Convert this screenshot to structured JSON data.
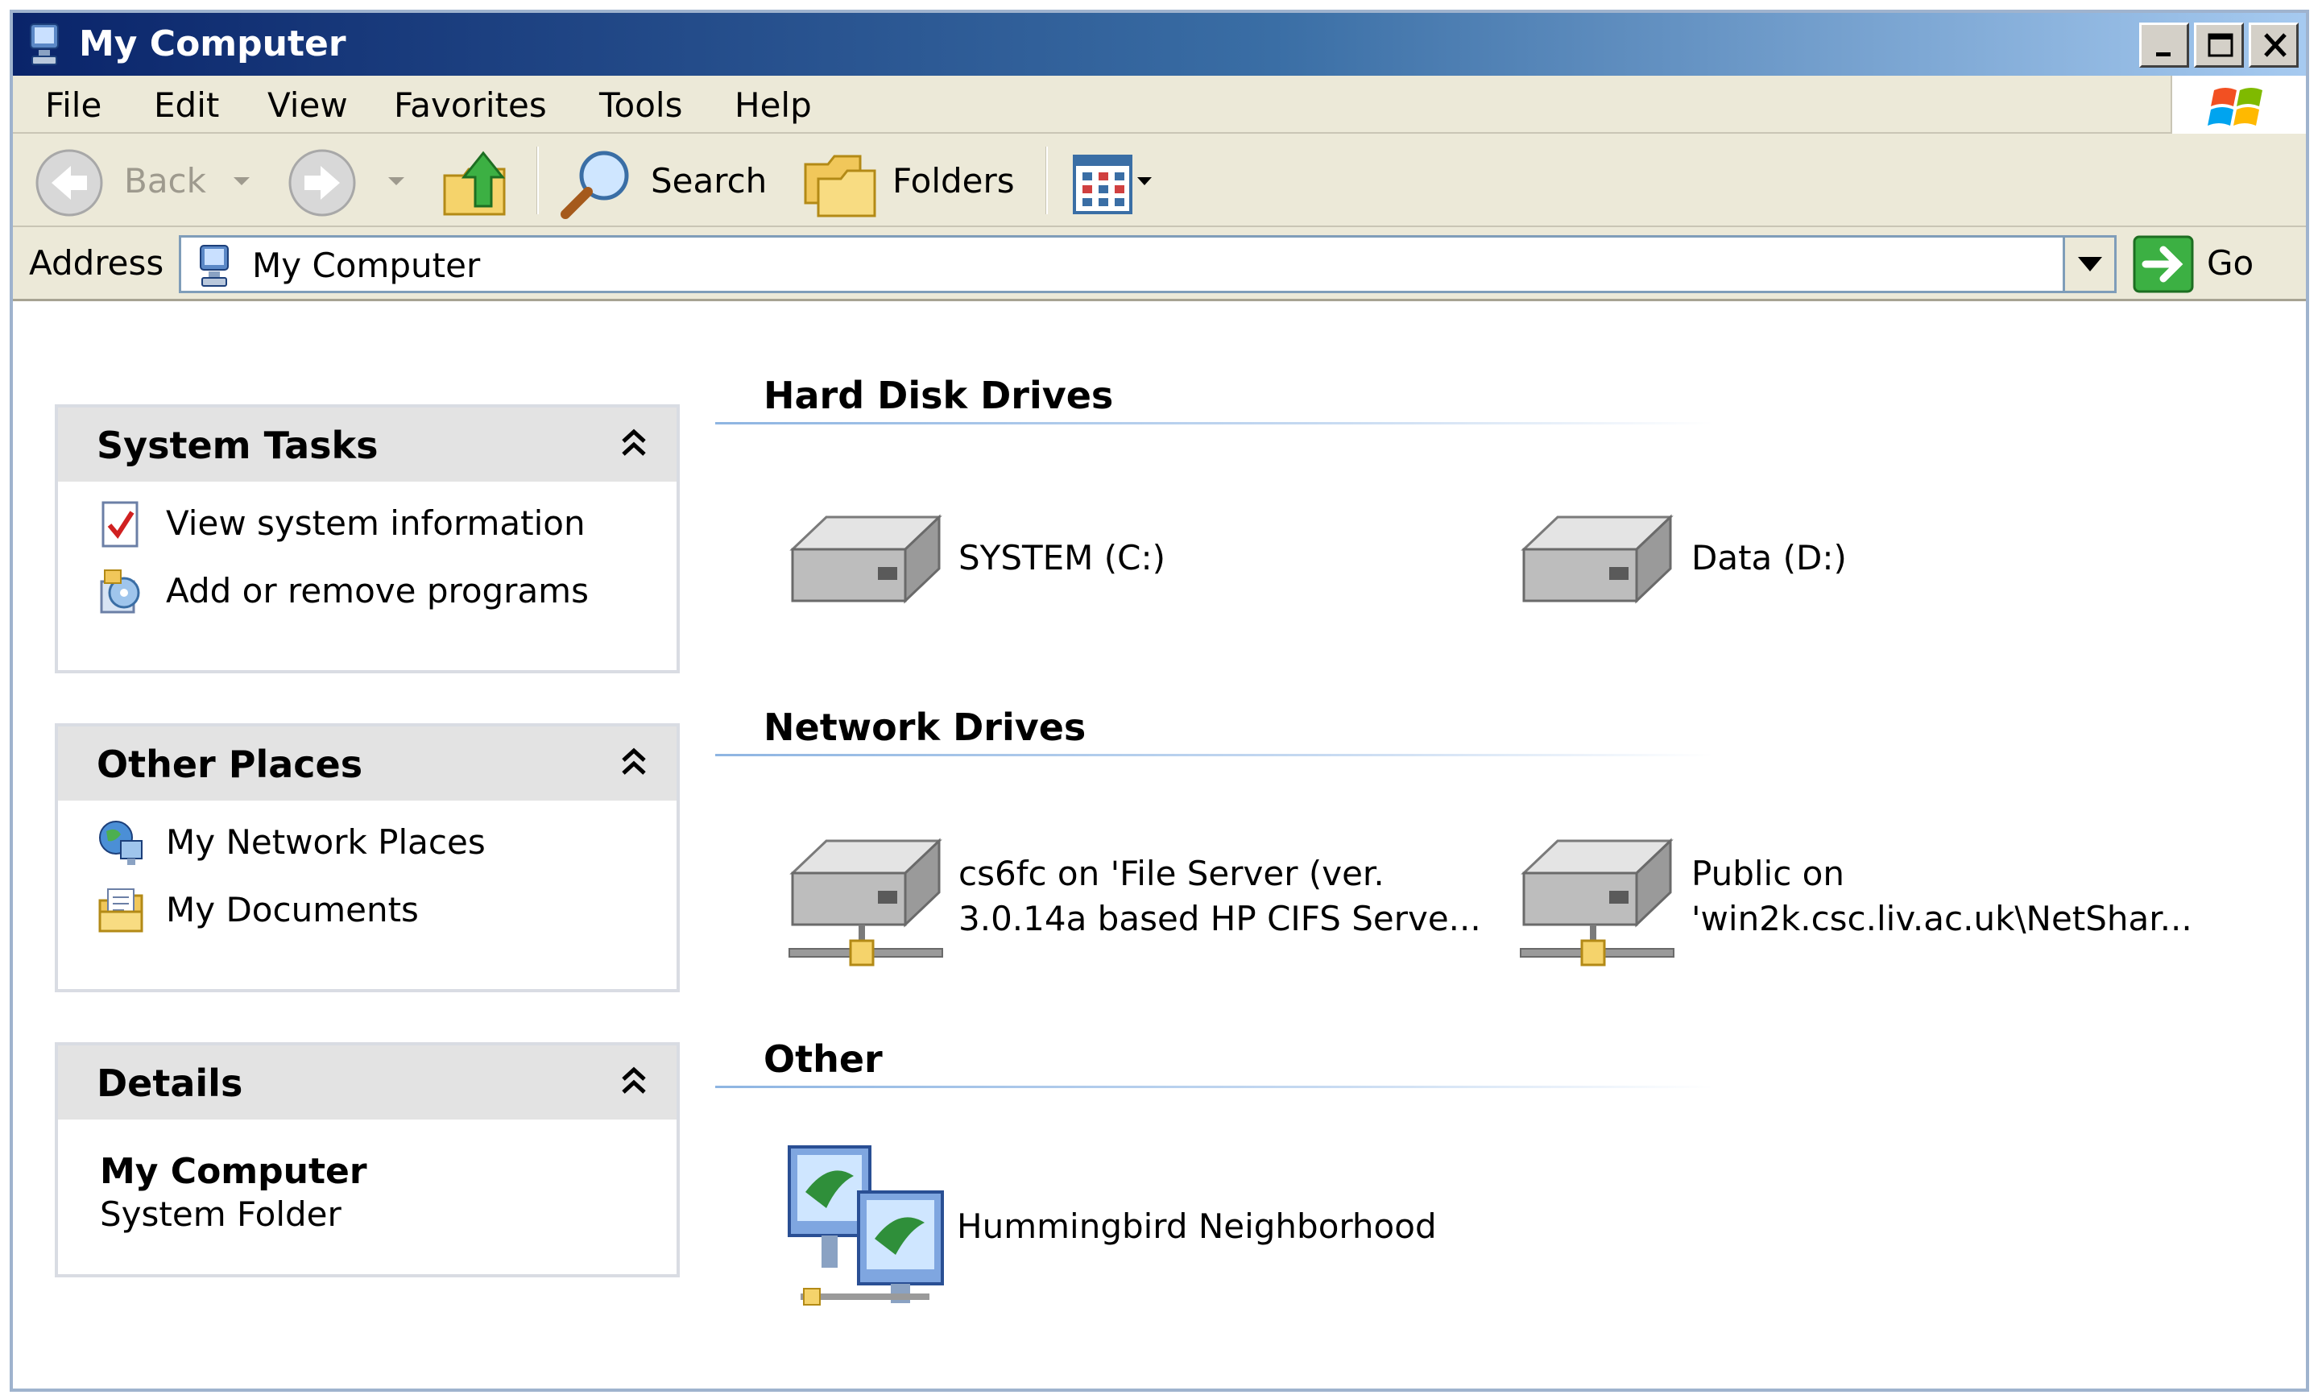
{
  "window": {
    "title": "My Computer"
  },
  "menu": [
    "File",
    "Edit",
    "View",
    "Favorites",
    "Tools",
    "Help"
  ],
  "toolbar": {
    "back_label": "Back",
    "search_label": "Search",
    "folders_label": "Folders"
  },
  "address": {
    "label": "Address",
    "value": "My Computer",
    "go_label": "Go"
  },
  "sidebar": {
    "system_tasks": {
      "title": "System Tasks",
      "items": [
        "View system information",
        "Add or remove programs"
      ]
    },
    "other_places": {
      "title": "Other Places",
      "items": [
        "My Network Places",
        "My Documents"
      ]
    },
    "details": {
      "title": "Details",
      "name": "My Computer",
      "type": "System Folder"
    }
  },
  "groups": {
    "hard_disks": {
      "title": "Hard Disk Drives",
      "items": [
        "SYSTEM (C:)",
        "Data (D:)"
      ]
    },
    "network": {
      "title": "Network Drives",
      "items": [
        {
          "line1": "cs6fc on 'File Server (ver.",
          "line2": "3.0.14a based HP CIFS Serve..."
        },
        {
          "line1": "Public on",
          "line2": "'win2k.csc.liv.ac.uk\\NetShar..."
        }
      ]
    },
    "other": {
      "title": "Other",
      "items": [
        "Hummingbird Neighborhood"
      ]
    }
  },
  "colors": {
    "title_bar_dark": "#0a246a",
    "title_bar_light": "#a6caf0",
    "chrome": "#ece9d8",
    "panel_header": "#e3e3e3",
    "group_rule": "#8eb5e2"
  }
}
